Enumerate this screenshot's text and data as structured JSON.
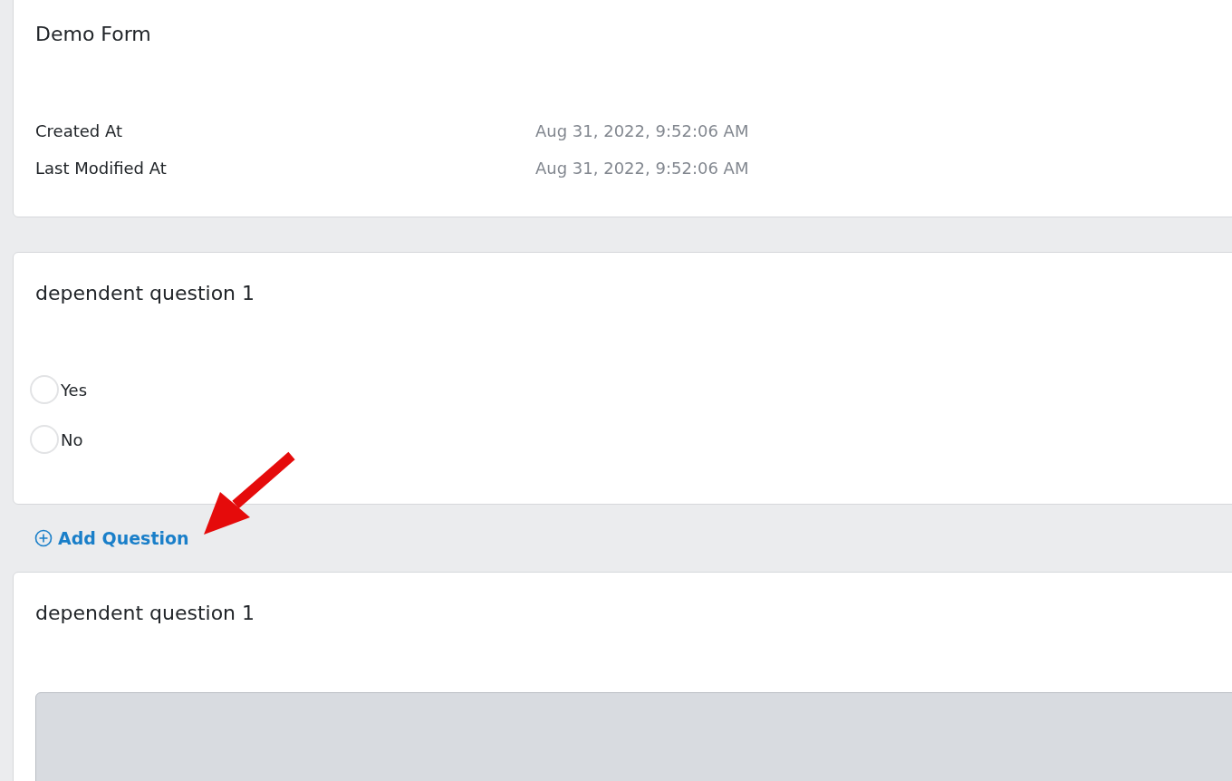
{
  "form": {
    "title": "Demo Form",
    "meta": [
      {
        "label": "Created At",
        "value": "Aug 31, 2022, 9:52:06 AM"
      },
      {
        "label": "Last Modified At",
        "value": "Aug 31, 2022, 9:52:06 AM"
      }
    ]
  },
  "questions": [
    {
      "kind": "choice",
      "title": "dependent question 1",
      "options": [
        {
          "label": "Yes",
          "selected": false
        },
        {
          "label": "No",
          "selected": false
        }
      ]
    },
    {
      "kind": "add_button",
      "label": "Add Question"
    },
    {
      "kind": "text",
      "title": "dependent question 1"
    }
  ]
}
